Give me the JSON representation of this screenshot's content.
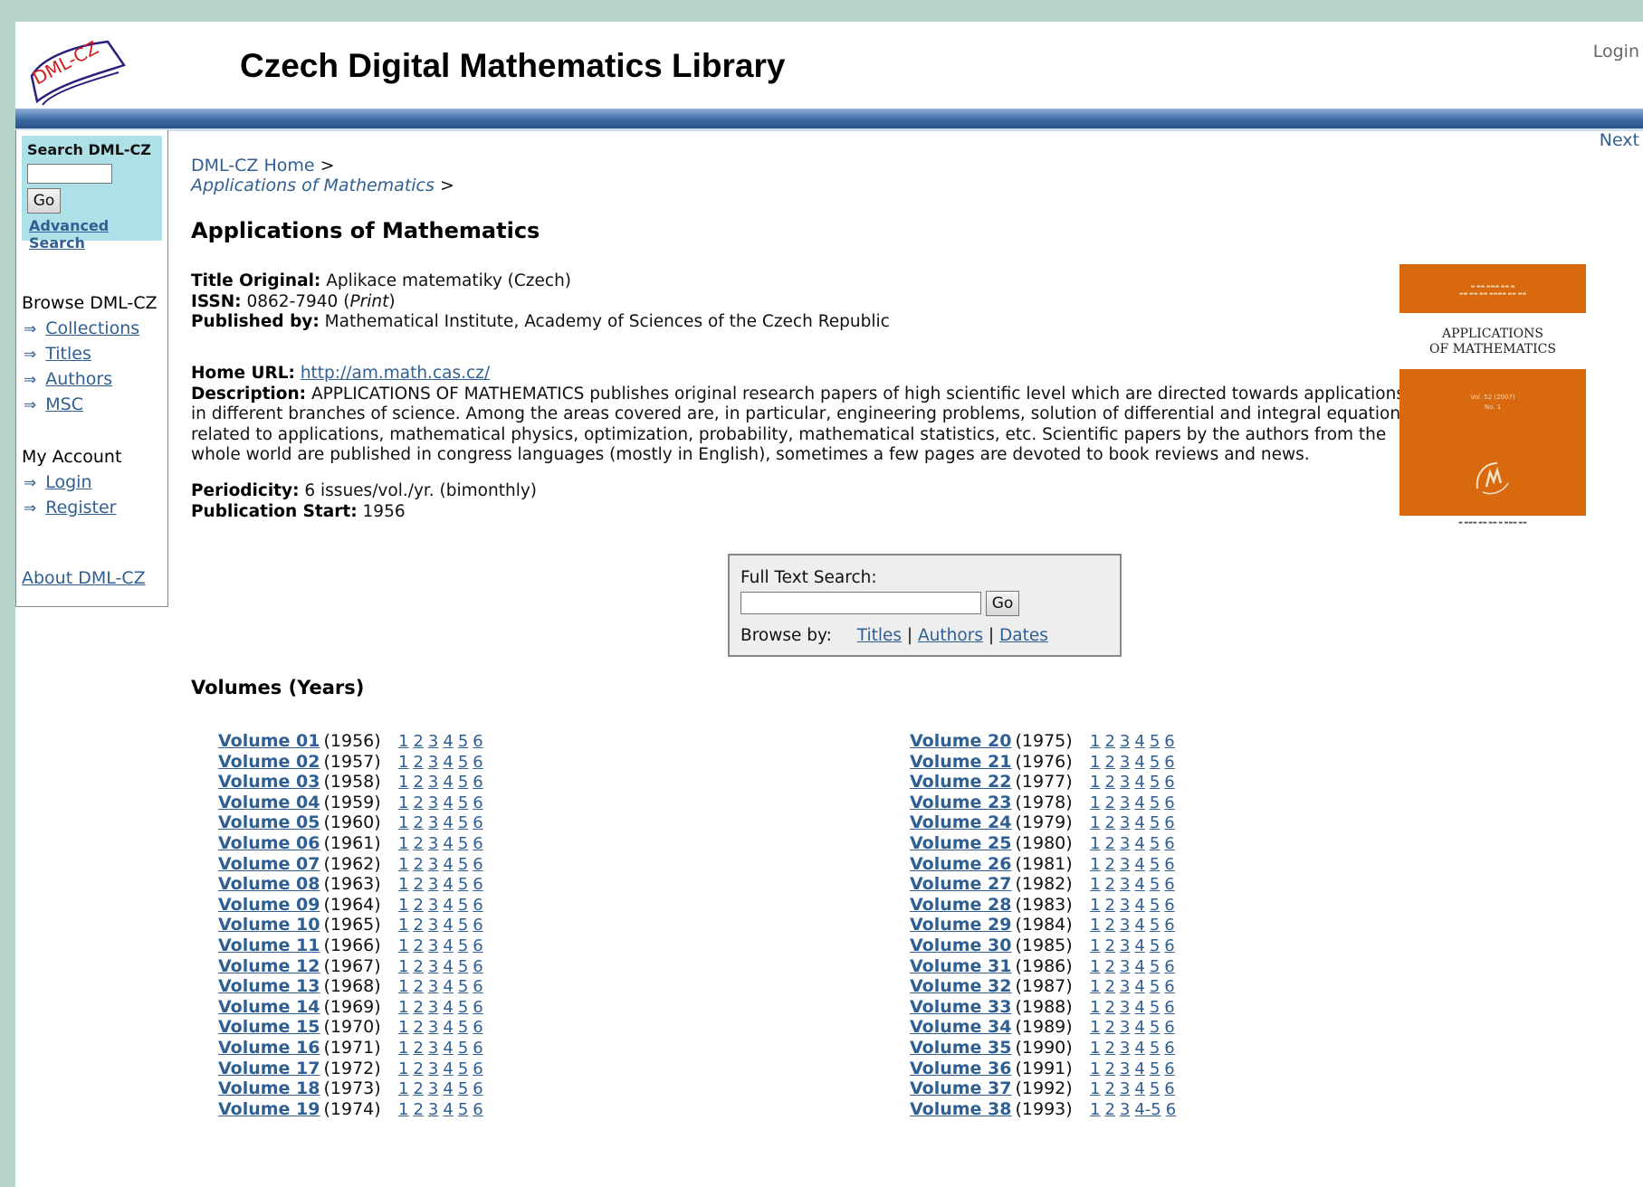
{
  "header": {
    "site_title": "Czech Digital Mathematics Library",
    "logo_text": "DML-CZ",
    "login": "Login",
    "next": "Next"
  },
  "sidebar": {
    "search_title": "Search DML-CZ",
    "search_value": "",
    "go": "Go",
    "advanced": "Advanced Search",
    "browse_heading": "Browse DML-CZ",
    "browse_items": [
      "Collections",
      "Titles",
      "Authors",
      "MSC"
    ],
    "account_heading": "My Account",
    "account_items": [
      "Login",
      "Register"
    ],
    "about": "About DML-CZ"
  },
  "breadcrumb": {
    "home": "DML-CZ Home",
    "current": "Applications of Mathematics",
    "sep": ">"
  },
  "title": "Applications of Mathematics",
  "meta": {
    "title_original_label": "Title Original:",
    "title_original": "Aplikace matematiky (Czech)",
    "issn_label": "ISSN:",
    "issn": "0862-7940",
    "issn_type": "Print",
    "published_by_label": "Published by:",
    "published_by": "Mathematical Institute, Academy of Sciences of the Czech Republic",
    "home_url_label": "Home URL:",
    "home_url": "http://am.math.cas.cz/",
    "description_label": "Description:",
    "description": "APPLICATIONS OF MATHEMATICS publishes original research papers of high scientific level which are directed towards applications in different branches of science. Among the areas covered are, in particular, engineering problems, solution of differential and integral equations related to applications, mathematical physics, optimization, probability, mathematical statistics, etc. Scientific papers by the authors from the whole world are published in congress languages (mostly in English), sometimes a few pages are devoted to book reviews and news.",
    "periodicity_label": "Periodicity:",
    "periodicity": "6 issues/vol./yr. (bimonthly)",
    "start_label": "Publication Start:",
    "start": "1956"
  },
  "cover": {
    "title_line1": "APPLICATIONS",
    "title_line2": "OF MATHEMATICS",
    "volume": "Vol. 52 (2007)",
    "number": "No. 1"
  },
  "fulltext": {
    "label": "Full Text Search:",
    "go": "Go",
    "browse_by": "Browse by:",
    "links": [
      "Titles",
      "Authors",
      "Dates"
    ],
    "sep": "|"
  },
  "volumes_heading": "Volumes (Years)",
  "volumes": [
    {
      "name": "Volume 01",
      "year": "(1956)",
      "issues": [
        "1",
        "2",
        "3",
        "4",
        "5",
        "6"
      ]
    },
    {
      "name": "Volume 02",
      "year": "(1957)",
      "issues": [
        "1",
        "2",
        "3",
        "4",
        "5",
        "6"
      ]
    },
    {
      "name": "Volume 03",
      "year": "(1958)",
      "issues": [
        "1",
        "2",
        "3",
        "4",
        "5",
        "6"
      ]
    },
    {
      "name": "Volume 04",
      "year": "(1959)",
      "issues": [
        "1",
        "2",
        "3",
        "4",
        "5",
        "6"
      ]
    },
    {
      "name": "Volume 05",
      "year": "(1960)",
      "issues": [
        "1",
        "2",
        "3",
        "4",
        "5",
        "6"
      ]
    },
    {
      "name": "Volume 06",
      "year": "(1961)",
      "issues": [
        "1",
        "2",
        "3",
        "4",
        "5",
        "6"
      ]
    },
    {
      "name": "Volume 07",
      "year": "(1962)",
      "issues": [
        "1",
        "2",
        "3",
        "4",
        "5",
        "6"
      ]
    },
    {
      "name": "Volume 08",
      "year": "(1963)",
      "issues": [
        "1",
        "2",
        "3",
        "4",
        "5",
        "6"
      ]
    },
    {
      "name": "Volume 09",
      "year": "(1964)",
      "issues": [
        "1",
        "2",
        "3",
        "4",
        "5",
        "6"
      ]
    },
    {
      "name": "Volume 10",
      "year": "(1965)",
      "issues": [
        "1",
        "2",
        "3",
        "4",
        "5",
        "6"
      ]
    },
    {
      "name": "Volume 11",
      "year": "(1966)",
      "issues": [
        "1",
        "2",
        "3",
        "4",
        "5",
        "6"
      ]
    },
    {
      "name": "Volume 12",
      "year": "(1967)",
      "issues": [
        "1",
        "2",
        "3",
        "4",
        "5",
        "6"
      ]
    },
    {
      "name": "Volume 13",
      "year": "(1968)",
      "issues": [
        "1",
        "2",
        "3",
        "4",
        "5",
        "6"
      ]
    },
    {
      "name": "Volume 14",
      "year": "(1969)",
      "issues": [
        "1",
        "2",
        "3",
        "4",
        "5",
        "6"
      ]
    },
    {
      "name": "Volume 15",
      "year": "(1970)",
      "issues": [
        "1",
        "2",
        "3",
        "4",
        "5",
        "6"
      ]
    },
    {
      "name": "Volume 16",
      "year": "(1971)",
      "issues": [
        "1",
        "2",
        "3",
        "4",
        "5",
        "6"
      ]
    },
    {
      "name": "Volume 17",
      "year": "(1972)",
      "issues": [
        "1",
        "2",
        "3",
        "4",
        "5",
        "6"
      ]
    },
    {
      "name": "Volume 18",
      "year": "(1973)",
      "issues": [
        "1",
        "2",
        "3",
        "4",
        "5",
        "6"
      ]
    },
    {
      "name": "Volume 19",
      "year": "(1974)",
      "issues": [
        "1",
        "2",
        "3",
        "4",
        "5",
        "6"
      ]
    },
    {
      "name": "Volume 20",
      "year": "(1975)",
      "issues": [
        "1",
        "2",
        "3",
        "4",
        "5",
        "6"
      ]
    },
    {
      "name": "Volume 21",
      "year": "(1976)",
      "issues": [
        "1",
        "2",
        "3",
        "4",
        "5",
        "6"
      ]
    },
    {
      "name": "Volume 22",
      "year": "(1977)",
      "issues": [
        "1",
        "2",
        "3",
        "4",
        "5",
        "6"
      ]
    },
    {
      "name": "Volume 23",
      "year": "(1978)",
      "issues": [
        "1",
        "2",
        "3",
        "4",
        "5",
        "6"
      ]
    },
    {
      "name": "Volume 24",
      "year": "(1979)",
      "issues": [
        "1",
        "2",
        "3",
        "4",
        "5",
        "6"
      ]
    },
    {
      "name": "Volume 25",
      "year": "(1980)",
      "issues": [
        "1",
        "2",
        "3",
        "4",
        "5",
        "6"
      ]
    },
    {
      "name": "Volume 26",
      "year": "(1981)",
      "issues": [
        "1",
        "2",
        "3",
        "4",
        "5",
        "6"
      ]
    },
    {
      "name": "Volume 27",
      "year": "(1982)",
      "issues": [
        "1",
        "2",
        "3",
        "4",
        "5",
        "6"
      ]
    },
    {
      "name": "Volume 28",
      "year": "(1983)",
      "issues": [
        "1",
        "2",
        "3",
        "4",
        "5",
        "6"
      ]
    },
    {
      "name": "Volume 29",
      "year": "(1984)",
      "issues": [
        "1",
        "2",
        "3",
        "4",
        "5",
        "6"
      ]
    },
    {
      "name": "Volume 30",
      "year": "(1985)",
      "issues": [
        "1",
        "2",
        "3",
        "4",
        "5",
        "6"
      ]
    },
    {
      "name": "Volume 31",
      "year": "(1986)",
      "issues": [
        "1",
        "2",
        "3",
        "4",
        "5",
        "6"
      ]
    },
    {
      "name": "Volume 32",
      "year": "(1987)",
      "issues": [
        "1",
        "2",
        "3",
        "4",
        "5",
        "6"
      ]
    },
    {
      "name": "Volume 33",
      "year": "(1988)",
      "issues": [
        "1",
        "2",
        "3",
        "4",
        "5",
        "6"
      ]
    },
    {
      "name": "Volume 34",
      "year": "(1989)",
      "issues": [
        "1",
        "2",
        "3",
        "4",
        "5",
        "6"
      ]
    },
    {
      "name": "Volume 35",
      "year": "(1990)",
      "issues": [
        "1",
        "2",
        "3",
        "4",
        "5",
        "6"
      ]
    },
    {
      "name": "Volume 36",
      "year": "(1991)",
      "issues": [
        "1",
        "2",
        "3",
        "4",
        "5",
        "6"
      ]
    },
    {
      "name": "Volume 37",
      "year": "(1992)",
      "issues": [
        "1",
        "2",
        "3",
        "4",
        "5",
        "6"
      ]
    },
    {
      "name": "Volume 38",
      "year": "(1993)",
      "issues": [
        "1",
        "2",
        "3",
        "4-5",
        "6"
      ]
    }
  ],
  "colors": {
    "link": "#2f5f93",
    "header_bar": "#3d6aa6",
    "sidebar_search_bg": "#aee0e7",
    "cover_orange": "#d8690e",
    "page_bg": "#b7d5cc"
  }
}
